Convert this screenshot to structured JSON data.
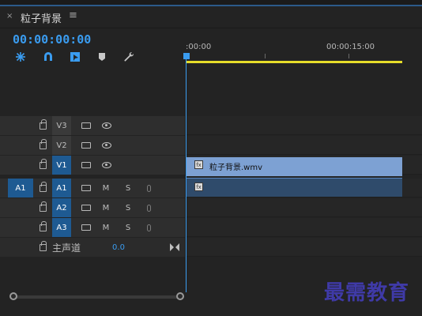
{
  "header": {
    "close_glyph": "×",
    "title": "粒子背景",
    "menu_glyph": "≡"
  },
  "timecode": "00:00:00:00",
  "toolbar": {
    "tools": [
      {
        "name": "insert-sequence-nest-icon"
      },
      {
        "name": "snap-magnet-icon"
      },
      {
        "name": "linked-selection-icon"
      },
      {
        "name": "add-marker-icon"
      },
      {
        "name": "wrench-settings-icon"
      }
    ]
  },
  "ruler": {
    "start_label": ":00:00",
    "mid_label": "00:00:15:00"
  },
  "tracks": {
    "video": [
      {
        "label": "V3",
        "targeted": false
      },
      {
        "label": "V2",
        "targeted": false
      },
      {
        "label": "V1",
        "targeted": true
      }
    ],
    "audio": [
      {
        "label": "A1",
        "source": "A1",
        "mute": "M",
        "solo": "S"
      },
      {
        "label": "A2",
        "mute": "M",
        "solo": "S"
      },
      {
        "label": "A3",
        "mute": "M",
        "solo": "S"
      }
    ],
    "master": {
      "label": "主声道",
      "value": "0.0"
    }
  },
  "clips": {
    "video": {
      "fx_label": "fx",
      "name": "粒子背景.wmv"
    },
    "audio": {
      "fx_label": "fx"
    }
  },
  "watermark": "最需教育",
  "colors": {
    "accent": "#3a9cf0",
    "target_blue": "#1e5a92",
    "clip_video": "#7da1d3",
    "clip_audio": "#2f4b6b",
    "work_area": "#e6dd2a"
  }
}
